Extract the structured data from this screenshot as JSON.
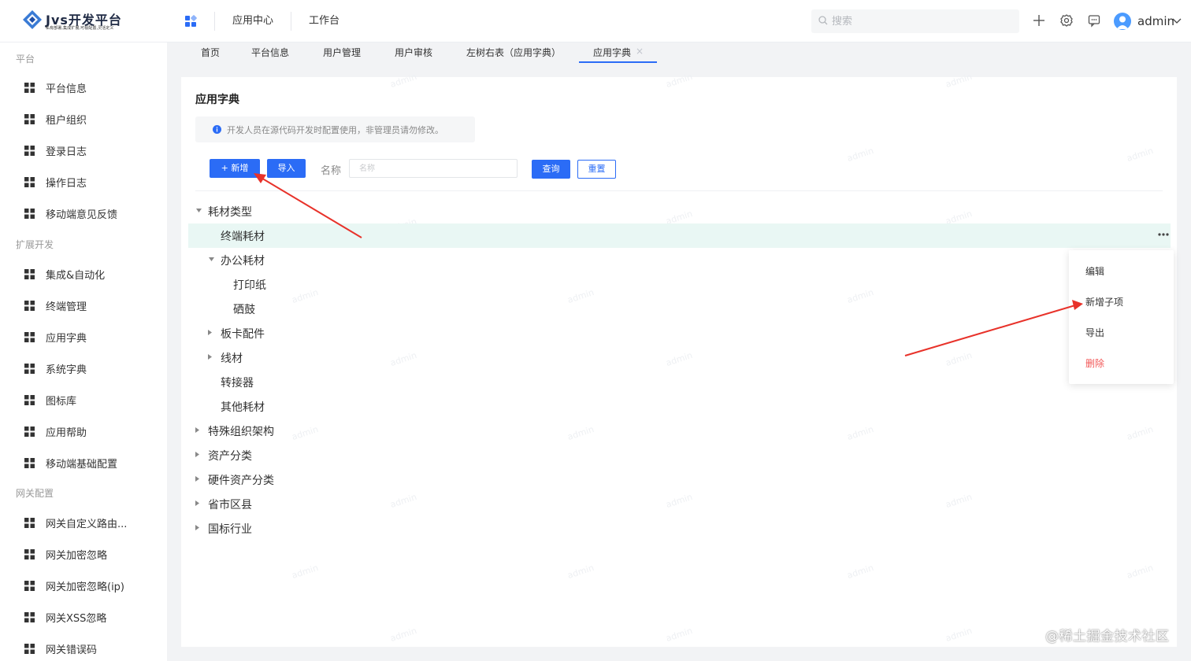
{
  "brand": {
    "title": "Jvs开发平台",
    "subtitle": "私有部署,集成扩展,可视配置,灵活定义"
  },
  "top_nav": {
    "items": [
      "应用中心",
      "工作台"
    ]
  },
  "search": {
    "placeholder": "搜索"
  },
  "user": {
    "name": "admin"
  },
  "sidebar": {
    "groups": [
      {
        "title": "平台",
        "items": [
          "平台信息",
          "租户组织",
          "登录日志",
          "操作日志",
          "移动端意见反馈"
        ]
      },
      {
        "title": "扩展开发",
        "items": [
          "集成&自动化",
          "终端管理",
          "应用字典",
          "系统字典",
          "图标库",
          "应用帮助",
          "移动端基础配置"
        ]
      },
      {
        "title": "网关配置",
        "items": [
          "网关自定义路由...",
          "网关加密忽略",
          "网关加密忽略(ip)",
          "网关XSS忽略",
          "网关错误码"
        ]
      }
    ]
  },
  "tabs": [
    "首页",
    "平台信息",
    "用户管理",
    "用户审核",
    "左树右表（应用字典）",
    "应用字典"
  ],
  "tab_close": "×",
  "page": {
    "title": "应用字典",
    "notice": "开发人员在源代码开发时配置使用，非管理员请勿修改。",
    "buttons": {
      "add": "+ 新增",
      "import": "导入",
      "query": "查询",
      "reset": "重置"
    },
    "name_label": "名称",
    "name_placeholder": "名称"
  },
  "tree": [
    {
      "label": "耗材类型",
      "level": 0,
      "caret": "expanded"
    },
    {
      "label": "终端耗材",
      "level": 1,
      "caret": "none",
      "selected": true
    },
    {
      "label": "办公耗材",
      "level": 1,
      "caret": "expanded"
    },
    {
      "label": "打印纸",
      "level": 2,
      "caret": "none"
    },
    {
      "label": "硒鼓",
      "level": 2,
      "caret": "none"
    },
    {
      "label": "板卡配件",
      "level": 1,
      "caret": "collapsed"
    },
    {
      "label": "线材",
      "level": 1,
      "caret": "collapsed"
    },
    {
      "label": "转接器",
      "level": 1,
      "caret": "none"
    },
    {
      "label": "其他耗材",
      "level": 1,
      "caret": "none"
    },
    {
      "label": "特殊组织架构",
      "level": 0,
      "caret": "collapsed"
    },
    {
      "label": "资产分类",
      "level": 0,
      "caret": "collapsed"
    },
    {
      "label": "硬件资产分类",
      "level": 0,
      "caret": "collapsed"
    },
    {
      "label": "省市区县",
      "level": 0,
      "caret": "collapsed"
    },
    {
      "label": "国标行业",
      "level": 0,
      "caret": "collapsed"
    }
  ],
  "context_menu": {
    "edit": "编辑",
    "add_child": "新增子项",
    "export": "导出",
    "delete": "删除"
  },
  "watermark_text": "admin",
  "corner_watermark": "@稀土掘金技术社区",
  "colors": {
    "primary": "#2b6cf6",
    "selected_row": "#e9f7f4",
    "danger": "#f25858",
    "arrow": "#e8322a"
  }
}
